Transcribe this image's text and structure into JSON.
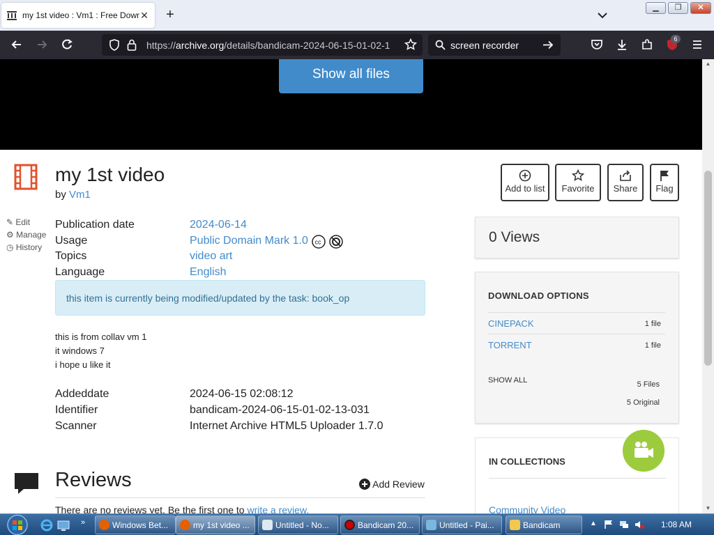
{
  "browser": {
    "tab_title": "my 1st video : Vm1 : Free Down",
    "url_host_prefix": "https://",
    "url_host": "archive.org",
    "url_path": "/details/bandicam-2024-06-15-01-02-1",
    "search_text": "screen recorder",
    "extension_badge": "6"
  },
  "player": {
    "show_all_files": "Show all files"
  },
  "item": {
    "title": "my 1st video",
    "by_prefix": "by",
    "creator": "Vm1"
  },
  "actions": {
    "add_to_list": "Add to list",
    "favorite": "Favorite",
    "share": "Share",
    "flag": "Flag"
  },
  "side_links": {
    "edit": "Edit",
    "manage": "Manage",
    "history": "History"
  },
  "metadata": {
    "pub_label": "Publication date",
    "pub_value": "2024-06-14",
    "usage_label": "Usage",
    "usage_value": "Public Domain Mark 1.0",
    "topics_label": "Topics",
    "topics_value": "video art",
    "lang_label": "Language",
    "lang_value": "English",
    "added_label": "Addeddate",
    "added_value": "2024-06-15 02:08:12",
    "ident_label": "Identifier",
    "ident_value": "bandicam-2024-06-15-01-02-13-031",
    "scanner_label": "Scanner",
    "scanner_value": "Internet Archive HTML5 Uploader 1.7.0"
  },
  "task_alert": "this item is currently being modified/updated by the task: book_op",
  "description": [
    "this is from collav vm 1",
    "it windows 7",
    "i hope u like it"
  ],
  "reviews": {
    "heading": "Reviews",
    "add_review": "Add Review",
    "none_text": "There are no reviews yet. Be the first one to",
    "write_link": "write a review."
  },
  "views": {
    "text": "0 Views"
  },
  "downloads": {
    "heading": "DOWNLOAD OPTIONS",
    "options": [
      {
        "name": "CINEPACK",
        "count": "1 file"
      },
      {
        "name": "TORRENT",
        "count": "1 file"
      }
    ],
    "show_all": "SHOW ALL",
    "files": "5 Files",
    "original": "5 Original"
  },
  "collections": {
    "heading": "IN COLLECTIONS",
    "item": "Community Video"
  },
  "taskbar": {
    "items": [
      {
        "label": "Windows Bet..."
      },
      {
        "label": "my 1st video ..."
      },
      {
        "label": "Untitled - No..."
      },
      {
        "label": "Bandicam 20..."
      },
      {
        "label": "Untitled - Pai..."
      },
      {
        "label": "Bandicam"
      }
    ],
    "clock": "1:08 AM"
  },
  "colors": {
    "link": "#428bca",
    "accent_button": "#428bca",
    "nav_dark": "#2b2a33",
    "alert_bg": "#d9edf7"
  }
}
